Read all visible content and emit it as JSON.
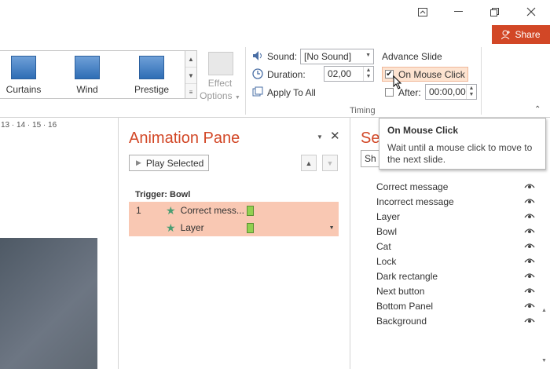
{
  "ribbon": {
    "transitions": [
      {
        "label": "Curtains",
        "icon": "curtains-icon"
      },
      {
        "label": "Wind",
        "icon": "wind-icon"
      },
      {
        "label": "Prestige",
        "icon": "prestige-icon"
      }
    ],
    "effect_options": {
      "line1": "Effect",
      "line2": "Options"
    },
    "timing": {
      "group_label": "Timing",
      "sound_label": "Sound:",
      "sound_value": "[No Sound]",
      "duration_label": "Duration:",
      "duration_value": "02,00",
      "apply_all_label": "Apply To All"
    },
    "advance": {
      "title": "Advance Slide",
      "on_click_label": "On Mouse Click",
      "on_click_checked": true,
      "after_label": "After:",
      "after_value": "00:00,00"
    }
  },
  "window": {
    "share_label": "Share"
  },
  "ruler": {
    "ticks": "13 · 14 · 15 · 16"
  },
  "animation_pane": {
    "title": "Animation Pane",
    "play_label": "Play Selected",
    "trigger_label": "Trigger: Bowl",
    "items": [
      {
        "number": "1",
        "name": "Correct mess..."
      },
      {
        "number": "",
        "name": "Layer"
      }
    ]
  },
  "selection_pane": {
    "title_visible": "Se",
    "show_all_visible": "Sh",
    "items": [
      "Correct message",
      "Incorrect message",
      "Layer",
      "Bowl",
      "Cat",
      "Lock",
      "Dark rectangle",
      "Next button",
      "Bottom Panel",
      "Background"
    ]
  },
  "tooltip": {
    "title": "On Mouse Click",
    "body": "Wait until a mouse click to move to the next slide."
  },
  "colors": {
    "accent": "#d24726",
    "anim_highlight": "#f9c8b3",
    "star": "#4a9d72"
  }
}
